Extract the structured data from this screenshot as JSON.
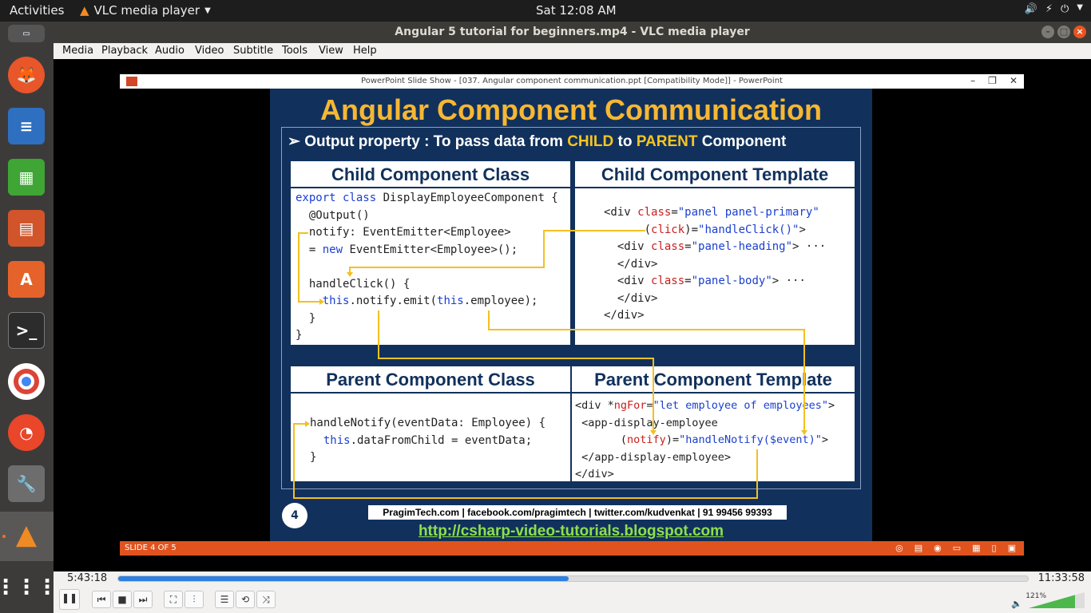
{
  "topbar": {
    "activities": "Activities",
    "app_name": "VLC media player",
    "clock": "Sat 12:08 AM"
  },
  "window": {
    "title": "Angular 5 tutorial for beginners.mp4 - VLC media player"
  },
  "menu": [
    "Media",
    "Playback",
    "Audio",
    "Video",
    "Subtitle",
    "Tools",
    "View",
    "Help"
  ],
  "ppt": {
    "window_title": "PowerPoint Slide Show - [037. Angular component communication.ppt [Compatibility Mode]] - PowerPoint",
    "status": "SLIDE 4 OF 5"
  },
  "slide": {
    "title": "Angular Component Communication",
    "subtitle_pre": "Output property : To pass data from ",
    "subtitle_child": "CHILD",
    "subtitle_mid": " to ",
    "subtitle_parent": "PARENT",
    "subtitle_post": " Component",
    "child_class_head": "Child Component Class",
    "child_template_head": "Child Component Template",
    "parent_class_head": "Parent Component Class",
    "parent_template_head": "Parent Component Template",
    "footer": "PragimTech.com | facebook.com/pragimtech | twitter.com/kudvenkat | 91 99456 99393",
    "url": "http://csharp-video-tutorials.blogspot.com",
    "number": "4"
  },
  "player": {
    "elapsed": "5:43:18",
    "total": "11:33:58",
    "progress": 0.495,
    "volume": "121%"
  }
}
